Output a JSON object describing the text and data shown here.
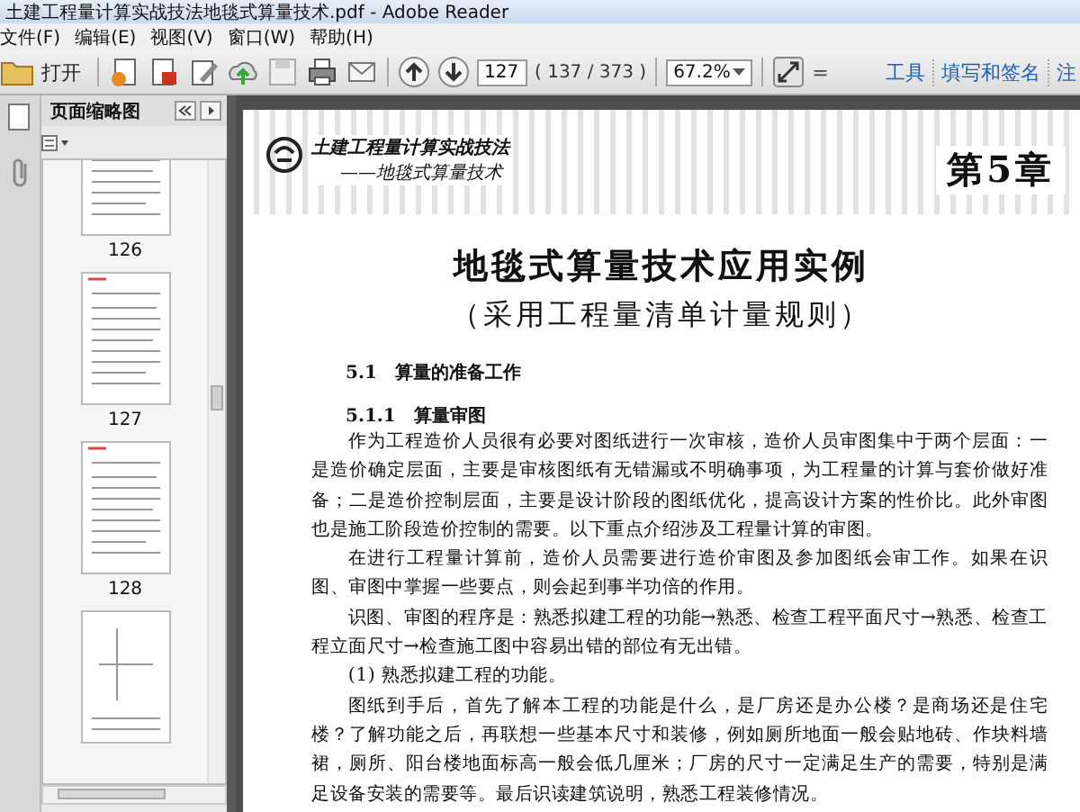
{
  "window": {
    "title": "土建工程量计算实战技法地毯式算量技术.pdf - Adobe Reader"
  },
  "menu": [
    "文件(F)",
    "编辑(E)",
    "视图(V)",
    "窗口(W)",
    "帮助(H)"
  ],
  "toolbar": {
    "open_label": "打开",
    "page_number": "127",
    "page_count": "( 137 / 373 )",
    "zoom": "67.2%",
    "menu_glyph": "=",
    "right_links": [
      "工具",
      "填写和签名",
      "注"
    ]
  },
  "sidebar": {
    "title": "页面缩略图",
    "thumbnails": [
      {
        "label": "126"
      },
      {
        "label": "127"
      },
      {
        "label": "128"
      }
    ]
  },
  "page": {
    "header": {
      "book_title": "土建工程量计算实战技法",
      "book_subtitle": "——地毯式算量技术",
      "chapter": "第5章"
    },
    "title": "地毯式算量技术应用实例",
    "subtitle": "（采用工程量清单计量规则）",
    "blocks": [
      {
        "kind": "heading",
        "text": "5.1　算量的准备工作"
      },
      {
        "kind": "subheading",
        "text": "5.1.1　算量审图"
      },
      {
        "kind": "paragraph",
        "text": "作为工程造价人员很有必要对图纸进行一次审核，造价人员审图集中于两个层面：一是造价确定层面，主要是审核图纸有无错漏或不明确事项，为工程量的计算与套价做好准备；二是造价控制层面，主要是设计阶段的图纸优化，提高设计方案的性价比。此外审图也是施工阶段造价控制的需要。以下重点介绍涉及工程量计算的审图。"
      },
      {
        "kind": "paragraph",
        "text": "在进行工程量计算前，造价人员需要进行造价审图及参加图纸会审工作。如果在识图、审图中掌握一些要点，则会起到事半功倍的作用。"
      },
      {
        "kind": "paragraph",
        "text": "识图、审图的程序是：熟悉拟建工程的功能→熟悉、检查工程平面尺寸→熟悉、检查工程立面尺寸→检查施工图中容易出错的部位有无出错。"
      },
      {
        "kind": "paragraph",
        "text": "(1) 熟悉拟建工程的功能。"
      },
      {
        "kind": "paragraph",
        "text": "图纸到手后，首先了解本工程的功能是什么，是厂房还是办公楼？是商场还是住宅楼？了解功能之后，再联想一些基本尺寸和装修，例如厕所地面一般会贴地砖、作块料墙裙，厕所、阳台楼地面标高一般会低几厘米；厂房的尺寸一定满足生产的需要，特别是满足设备安装的需要等。最后识读建筑说明，熟悉工程装修情况。"
      }
    ]
  }
}
